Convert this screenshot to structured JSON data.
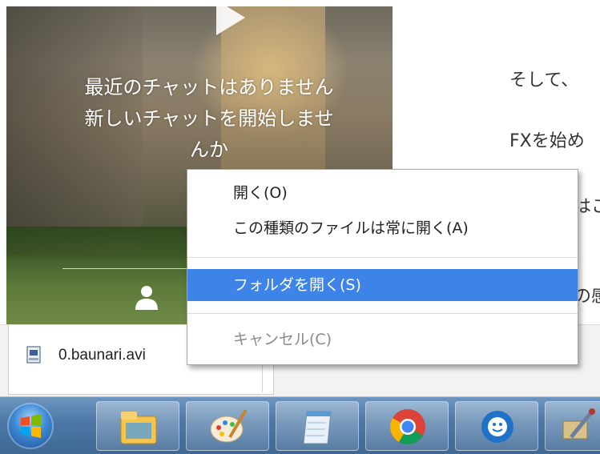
{
  "chat": {
    "line1": "最近のチャットはありません",
    "line2": "新しいチャットを開始しませ",
    "line3": "んか"
  },
  "right_text": {
    "line1": "そして、",
    "line2": "FXを始め",
    "line3": "はこ",
    "line4": "の感"
  },
  "context_menu": {
    "items": [
      {
        "label": "開く(O)",
        "state": "normal"
      },
      {
        "label": "この種類のファイルは常に開く(A)",
        "state": "normal"
      },
      {
        "label": "フォルダを開く(S)",
        "state": "highlighted"
      },
      {
        "label": "キャンセル(C)",
        "state": "disabled"
      }
    ]
  },
  "download": {
    "file_name": "0.baunari.avi",
    "icon": "video-file-icon"
  },
  "taskbar": {
    "start": "windows-start-icon",
    "apps": [
      "file-explorer-icon",
      "paint-icon",
      "notepad-icon",
      "chrome-icon",
      "messenger-icon",
      "tool-icon"
    ]
  },
  "colors": {
    "menu_highlight": "#3d83e8",
    "taskbar": "#4f7aa8"
  }
}
